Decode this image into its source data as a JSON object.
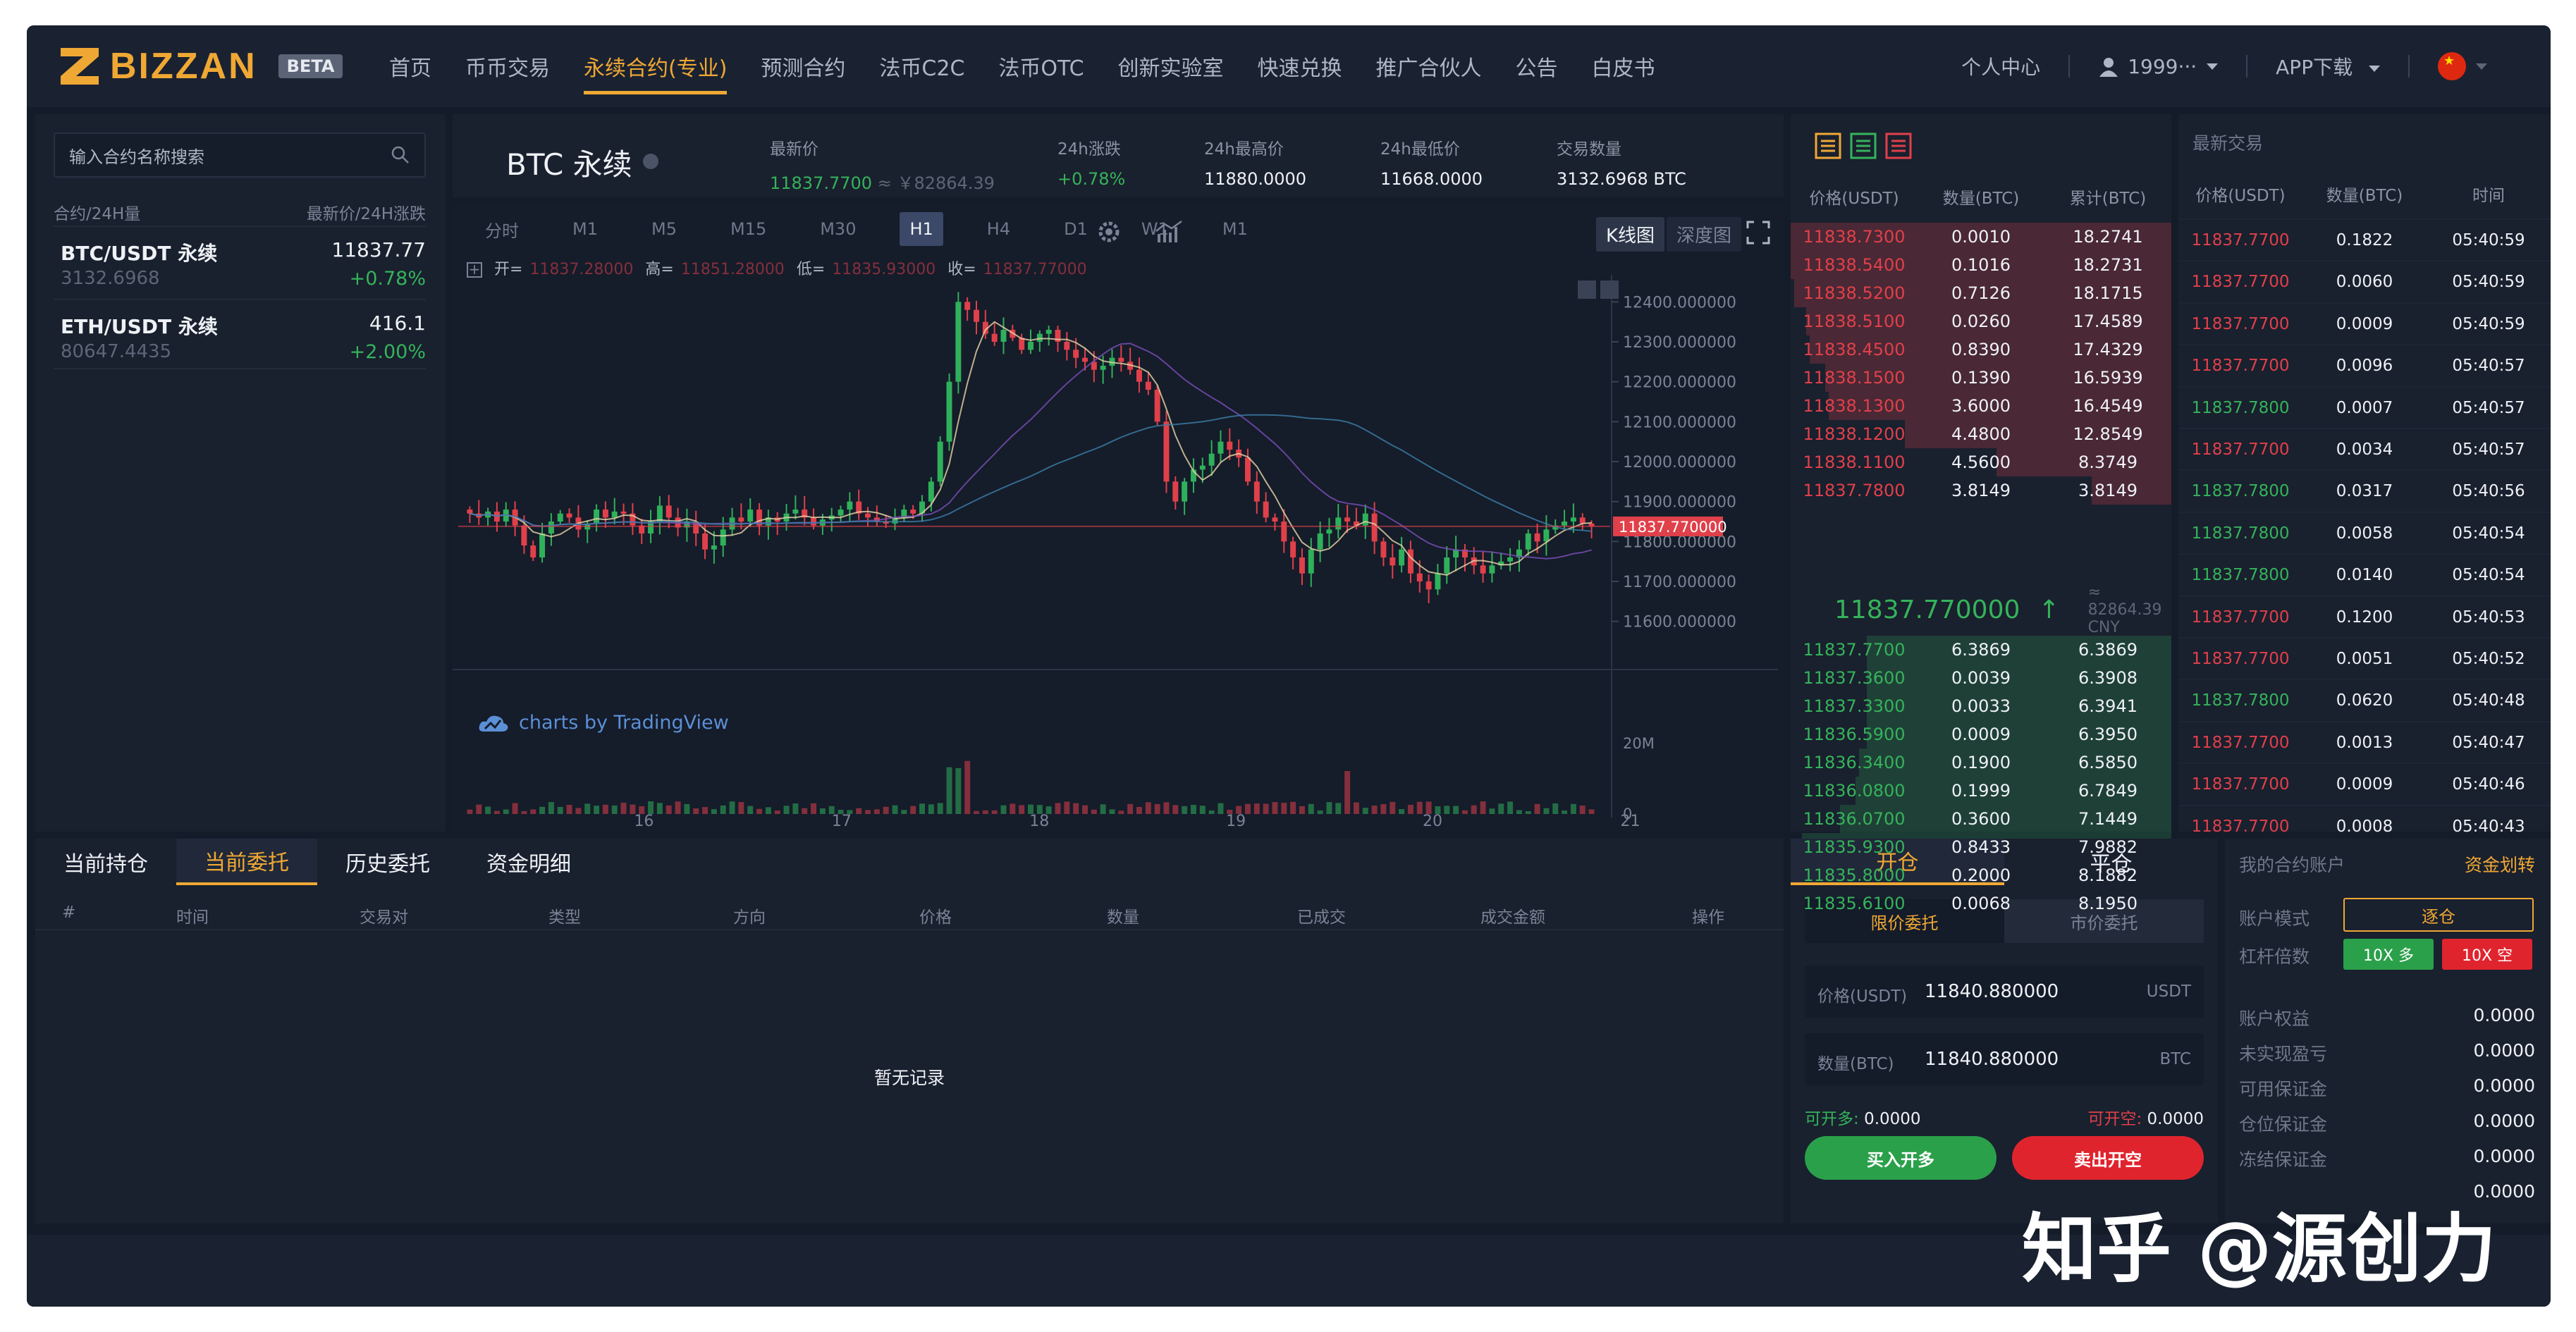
{
  "nav": {
    "logo_text": "BIZZAN",
    "beta_label": "BETA",
    "menu": [
      "首页",
      "币币交易",
      "永续合约(专业)",
      "预测合约",
      "法币C2C",
      "法币OTC",
      "创新实验室",
      "快速兑换",
      "推广合伙人",
      "公告",
      "白皮书"
    ],
    "active_index": 2,
    "personal_center": "个人中心",
    "user": "1999···",
    "app_download": "APP下载"
  },
  "market": {
    "search_placeholder": "输入合约名称搜索",
    "header_left": "合约/24H量",
    "header_right": "最新价/24H涨跌",
    "rows": [
      {
        "name": "BTC/USDT 永续",
        "volume": "3132.6968",
        "price": "11837.77",
        "change": "+0.78%"
      },
      {
        "name": "ETH/USDT 永续",
        "volume": "80647.4435",
        "price": "416.1",
        "change": "+2.00%"
      }
    ]
  },
  "ticker": {
    "symbol": "BTC 永续",
    "last_label": "最新价",
    "last_value": "11837.7700",
    "last_cny": "≈ ￥82864.39",
    "change_label": "24h涨跌",
    "change_value": "+0.78%",
    "high_label": "24h最高价",
    "high_value": "11880.0000",
    "low_label": "24h最低价",
    "low_value": "11668.0000",
    "volume_label": "交易数量",
    "volume_value": "3132.6968 BTC"
  },
  "chart_toolbar": {
    "timeframes": [
      "分时",
      "M1",
      "M5",
      "M15",
      "M30",
      "H1",
      "H4",
      "D1",
      "W1",
      "M1"
    ],
    "active_index": 5,
    "kline_label": "K线图",
    "depth_label": "深度图",
    "ohlc": {
      "open_label": "开=",
      "open": "11837.28000",
      "high_label": "高=",
      "high": "11851.28000",
      "low_label": "低=",
      "low": "11835.93000",
      "close_label": "收=",
      "close": "11837.77000"
    },
    "credit": "charts by TradingView",
    "price_tag": "11837.770000"
  },
  "chart_data": {
    "type": "candlestick",
    "x_ticks": [
      "16",
      "17",
      "18",
      "19",
      "20",
      "21"
    ],
    "y_ticks": [
      "12400.000000",
      "12300.000000",
      "12200.000000",
      "12100.000000",
      "12000.000000",
      "11900.000000",
      "11800.000000",
      "11700.000000",
      "11600.000000"
    ],
    "ylim": [
      11550,
      12450
    ],
    "volume_ticks": [
      "20M",
      "0"
    ],
    "last_price": 11837.77,
    "closes": [
      11870,
      11860,
      11875,
      11850,
      11880,
      11840,
      11790,
      11760,
      11820,
      11850,
      11870,
      11860,
      11830,
      11845,
      11880,
      11860,
      11875,
      11870,
      11840,
      11820,
      11850,
      11890,
      11860,
      11835,
      11850,
      11820,
      11780,
      11790,
      11830,
      11860,
      11850,
      11880,
      11840,
      11860,
      11850,
      11870,
      11880,
      11860,
      11840,
      11855,
      11865,
      11880,
      11900,
      11870,
      11860,
      11850,
      11845,
      11860,
      11880,
      11870,
      11900,
      11950,
      12050,
      12200,
      12400,
      12380,
      12350,
      12320,
      12300,
      12330,
      12310,
      12280,
      12300,
      12320,
      12330,
      12300,
      12280,
      12260,
      12250,
      12230,
      12240,
      12260,
      12250,
      12230,
      12200,
      12180,
      12100,
      11950,
      11900,
      11950,
      11980,
      11990,
      12020,
      12050,
      12030,
      12010,
      11950,
      11900,
      11860,
      11850,
      11800,
      11760,
      11720,
      11780,
      11820,
      11830,
      11860,
      11850,
      11840,
      11870,
      11800,
      11760,
      11740,
      11780,
      11720,
      11700,
      11680,
      11720,
      11760,
      11780,
      11760,
      11740,
      11720,
      11740,
      11750,
      11760,
      11780,
      11820,
      11800,
      11830,
      11840,
      11850,
      11860,
      11845,
      11838
    ]
  },
  "orderbook": {
    "headers": [
      "价格(USDT)",
      "数量(BTC)",
      "累计(BTC)"
    ],
    "asks": [
      {
        "price": "11838.7300",
        "qty": "0.0010",
        "total": "18.2741",
        "depth": 1.0
      },
      {
        "price": "11838.5400",
        "qty": "0.1016",
        "total": "18.2731",
        "depth": 1.0
      },
      {
        "price": "11838.5200",
        "qty": "0.7126",
        "total": "18.1715",
        "depth": 0.99
      },
      {
        "price": "11838.5100",
        "qty": "0.0260",
        "total": "17.4589",
        "depth": 0.96
      },
      {
        "price": "11838.4500",
        "qty": "0.8390",
        "total": "17.4329",
        "depth": 0.95
      },
      {
        "price": "11838.1500",
        "qty": "0.1390",
        "total": "16.5939",
        "depth": 0.91
      },
      {
        "price": "11838.1300",
        "qty": "3.6000",
        "total": "16.4549",
        "depth": 0.9
      },
      {
        "price": "11838.1200",
        "qty": "4.4800",
        "total": "12.8549",
        "depth": 0.7
      },
      {
        "price": "11838.1100",
        "qty": "4.5600",
        "total": "8.3749",
        "depth": 0.46
      },
      {
        "price": "11837.7800",
        "qty": "3.8149",
        "total": "3.8149",
        "depth": 0.21
      }
    ],
    "mid_price": "11837.770000",
    "mid_arrow": "↑",
    "mid_cny": "≈ 82864.39 CNY",
    "bids": [
      {
        "price": "11837.7700",
        "qty": "6.3869",
        "total": "6.3869",
        "depth": 0.8
      },
      {
        "price": "11837.3600",
        "qty": "0.0039",
        "total": "6.3908",
        "depth": 0.8
      },
      {
        "price": "11837.3300",
        "qty": "0.0033",
        "total": "6.3941",
        "depth": 0.8
      },
      {
        "price": "11836.5900",
        "qty": "0.0009",
        "total": "6.3950",
        "depth": 0.8
      },
      {
        "price": "11836.3400",
        "qty": "0.1900",
        "total": "6.5850",
        "depth": 0.82
      },
      {
        "price": "11836.0800",
        "qty": "0.1999",
        "total": "6.7849",
        "depth": 0.83
      },
      {
        "price": "11836.0700",
        "qty": "0.3600",
        "total": "7.1449",
        "depth": 0.87
      },
      {
        "price": "11835.9300",
        "qty": "0.8433",
        "total": "7.9882",
        "depth": 0.97
      },
      {
        "price": "11835.8000",
        "qty": "0.2000",
        "total": "8.1882",
        "depth": 1.0
      },
      {
        "price": "11835.6100",
        "qty": "0.0068",
        "total": "8.1950",
        "depth": 1.0
      }
    ]
  },
  "trades": {
    "title": "最新交易",
    "headers": [
      "价格(USDT)",
      "数量(BTC)",
      "时间"
    ],
    "rows": [
      {
        "price": "11837.7700",
        "qty": "0.1822",
        "time": "05:40:59",
        "side": "sell"
      },
      {
        "price": "11837.7700",
        "qty": "0.0060",
        "time": "05:40:59",
        "side": "sell"
      },
      {
        "price": "11837.7700",
        "qty": "0.0009",
        "time": "05:40:59",
        "side": "sell"
      },
      {
        "price": "11837.7700",
        "qty": "0.0096",
        "time": "05:40:57",
        "side": "sell"
      },
      {
        "price": "11837.7800",
        "qty": "0.0007",
        "time": "05:40:57",
        "side": "buy"
      },
      {
        "price": "11837.7700",
        "qty": "0.0034",
        "time": "05:40:57",
        "side": "sell"
      },
      {
        "price": "11837.7800",
        "qty": "0.0317",
        "time": "05:40:56",
        "side": "buy"
      },
      {
        "price": "11837.7800",
        "qty": "0.0058",
        "time": "05:40:54",
        "side": "buy"
      },
      {
        "price": "11837.7800",
        "qty": "0.0140",
        "time": "05:40:54",
        "side": "buy"
      },
      {
        "price": "11837.7700",
        "qty": "0.1200",
        "time": "05:40:53",
        "side": "sell"
      },
      {
        "price": "11837.7700",
        "qty": "0.0051",
        "time": "05:40:52",
        "side": "sell"
      },
      {
        "price": "11837.7800",
        "qty": "0.0620",
        "time": "05:40:48",
        "side": "buy"
      },
      {
        "price": "11837.7700",
        "qty": "0.0013",
        "time": "05:40:47",
        "side": "sell"
      },
      {
        "price": "11837.7700",
        "qty": "0.0009",
        "time": "05:40:46",
        "side": "sell"
      },
      {
        "price": "11837.7700",
        "qty": "0.0008",
        "time": "05:40:43",
        "side": "sell"
      }
    ]
  },
  "orders": {
    "tabs": [
      "当前持仓",
      "当前委托",
      "历史委托",
      "资金明细"
    ],
    "active_index": 1,
    "columns": [
      "#",
      "时间",
      "交易对",
      "类型",
      "方向",
      "价格",
      "数量",
      "已成交",
      "成交金额",
      "操作"
    ],
    "empty_text": "暂无记录"
  },
  "trade_form": {
    "tabs": [
      "开仓",
      "平仓"
    ],
    "types": [
      "限价委托",
      "市价委托"
    ],
    "price_label": "价格(USDT)",
    "price_value": "11840.880000",
    "price_unit": "USDT",
    "qty_label": "数量(BTC)",
    "qty_value": "11840.880000",
    "qty_unit": "BTC",
    "open_long_label": "可开多:",
    "open_long_value": "0.0000",
    "open_short_label": "可开空:",
    "open_short_value": "0.0000",
    "buy_button": "买入开多",
    "sell_button": "卖出开空"
  },
  "account": {
    "title": "我的合约账户",
    "transfer": "资金划转",
    "mode_label": "账户模式",
    "mode_value": "逐仓",
    "leverage_label": "杠杆倍数",
    "long_lev": "10X 多",
    "short_lev": "10X 空",
    "rows": [
      {
        "label": "账户权益",
        "value": "0.0000"
      },
      {
        "label": "未实现盈亏",
        "value": "0.0000"
      },
      {
        "label": "可用保证金",
        "value": "0.0000"
      },
      {
        "label": "仓位保证金",
        "value": "0.0000"
      },
      {
        "label": "冻结保证金",
        "value": "0.0000"
      },
      {
        "label": "",
        "value": "0.0000"
      }
    ]
  },
  "watermark": "知乎 @源创力",
  "colors": {
    "accent": "#f0a834",
    "up": "#35b35a",
    "down": "#e0404a",
    "bg": "#141b29",
    "panel": "#19202e"
  }
}
